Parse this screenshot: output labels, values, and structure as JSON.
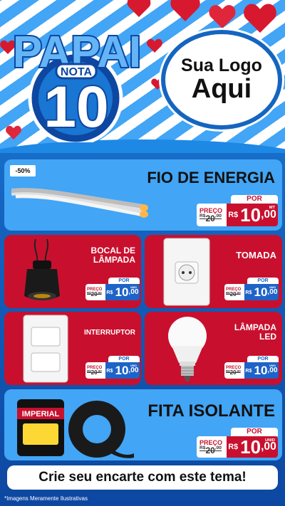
{
  "header": {
    "badge_title": "PAPAI",
    "badge_subtitle": "NOTA",
    "badge_number": "10",
    "logo_line1": "Sua Logo",
    "logo_line2": "Aqui"
  },
  "colors": {
    "red": "#c8102e",
    "blue_card": "#42a5f5",
    "blue_dark": "#1565c0",
    "tag_blue": "#1e63c7"
  },
  "products": [
    {
      "name": "FIO DE ENERGIA",
      "discount": "-50%",
      "por": "POR",
      "preco": "PREÇO",
      "old_prefix": "R$",
      "old_value": "20",
      "old_cents": ",00",
      "currency": "R$",
      "price": "10",
      "cents": ",00",
      "unit": "MT",
      "icon": "electric-cable-image"
    },
    {
      "name_line1": "BOCAL DE",
      "name_line2": "LÂMPADA",
      "por": "POR",
      "preco": "PREÇO",
      "old_prefix": "R$",
      "old_value": "20",
      "old_cents": ",00",
      "currency": "R$",
      "price": "10",
      "cents": ",00",
      "unit": "UNID",
      "icon": "lamp-socket-image"
    },
    {
      "name": "TOMADA",
      "por": "POR",
      "preco": "PREÇO",
      "old_prefix": "R$",
      "old_value": "20",
      "old_cents": ",00",
      "currency": "R$",
      "price": "10",
      "cents": ",00",
      "unit": "UNID",
      "icon": "wall-outlet-image"
    },
    {
      "name": "INTERRUPTOR",
      "por": "POR",
      "preco": "PREÇO",
      "old_prefix": "R$",
      "old_value": "20",
      "old_cents": ",00",
      "currency": "R$",
      "price": "10",
      "cents": ",00",
      "unit": "UNID",
      "icon": "light-switch-image"
    },
    {
      "name_line1": "LÂMPADA",
      "name_line2": "LED",
      "por": "POR",
      "preco": "PREÇO",
      "old_prefix": "R$",
      "old_value": "20",
      "old_cents": ",00",
      "currency": "R$",
      "price": "10",
      "cents": ",00",
      "unit": "UNID",
      "icon": "led-bulb-image"
    },
    {
      "name": "FITA ISOLANTE",
      "por": "POR",
      "preco": "PREÇO",
      "old_prefix": "R$",
      "old_value": "20",
      "old_cents": ",00",
      "currency": "R$",
      "price": "10",
      "cents": ",00",
      "unit": "UNID",
      "icon": "insulating-tape-image",
      "brand": "IMPERIAL"
    }
  ],
  "footer": {
    "cta": "Crie seu encarte com este tema!",
    "disclaimer": "*Imagens Meramente Ilustrativas"
  }
}
